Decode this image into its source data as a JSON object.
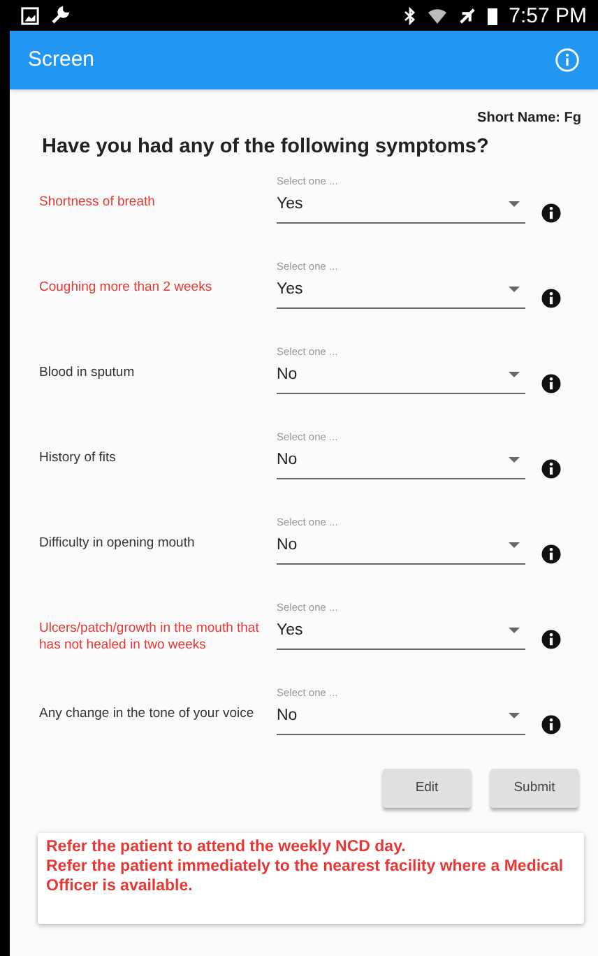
{
  "status_bar": {
    "time": "7:57 PM"
  },
  "app_bar": {
    "title": "Screen"
  },
  "short_name": "Short Name: Fg",
  "heading": "Have you had any of the following symptoms?",
  "questions": [
    {
      "label": "Shortness of breath",
      "flagged": true,
      "hint": "Select one ...",
      "value": "Yes"
    },
    {
      "label": "Coughing more than 2 weeks",
      "flagged": true,
      "hint": "Select one ...",
      "value": "Yes"
    },
    {
      "label": "Blood in sputum",
      "flagged": false,
      "hint": "Select one ...",
      "value": "No"
    },
    {
      "label": "History of fits",
      "flagged": false,
      "hint": "Select one ...",
      "value": "No"
    },
    {
      "label": "Difficulty in opening mouth",
      "flagged": false,
      "hint": "Select one ...",
      "value": "No"
    },
    {
      "label": "Ulcers/patch/growth in the mouth that has not healed in two weeks",
      "flagged": true,
      "hint": "Select one ...",
      "value": "Yes"
    },
    {
      "label": "Any change in the tone of your voice",
      "flagged": false,
      "hint": "Select one ...",
      "value": "No"
    }
  ],
  "buttons": [
    "Edit",
    "Submit"
  ],
  "messages": [
    "Refer the patient to attend the weekly NCD day.",
    "Refer the patient immediately to the nearest facility where a Medical Officer is available."
  ]
}
